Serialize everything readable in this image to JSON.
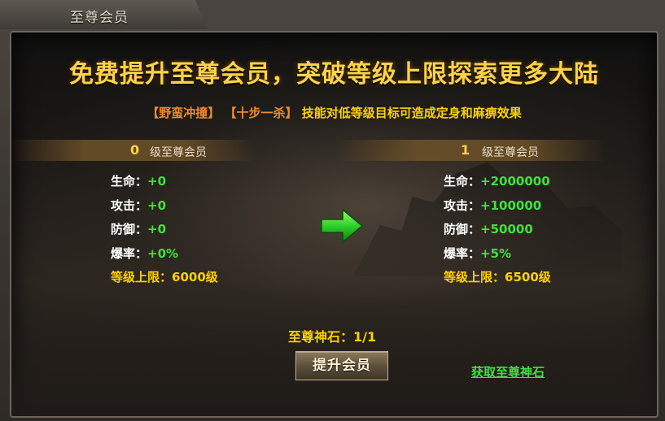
{
  "window": {
    "title": "至尊会员"
  },
  "headline": "免费提升至尊会员，突破等级上限探索更多大陆",
  "skill_line": {
    "skill1": "【野蛮冲撞】",
    "skill2": "【十步一杀】",
    "desc": "技能对低等级目标可造成定身和麻痹效果"
  },
  "current": {
    "level": "0",
    "level_label": "级至尊会员",
    "stats": [
      {
        "key": "生命：",
        "value": "+0"
      },
      {
        "key": "攻击：",
        "value": "+0"
      },
      {
        "key": "防御：",
        "value": "+0"
      },
      {
        "key": "爆率：",
        "value": "+0%"
      }
    ],
    "cap_key": "等级上限：",
    "cap_value": "6000级"
  },
  "next": {
    "level": "1",
    "level_label": "级至尊会员",
    "stats": [
      {
        "key": "生命：",
        "value": "+2000000"
      },
      {
        "key": "攻击：",
        "value": "+100000"
      },
      {
        "key": "防御：",
        "value": "+50000"
      },
      {
        "key": "爆率：",
        "value": "+5%"
      }
    ],
    "cap_key": "等级上限：",
    "cap_value": "6500级"
  },
  "stone": {
    "label": "至尊神石：",
    "value": "1/1"
  },
  "upgrade_button": "提升会员",
  "get_stone_link": "获取至尊神石",
  "colors": {
    "gold": "#ffd100",
    "green": "#3ee23e",
    "orange": "#f08a2c"
  },
  "icons": {
    "arrow": "arrow-right-icon"
  }
}
